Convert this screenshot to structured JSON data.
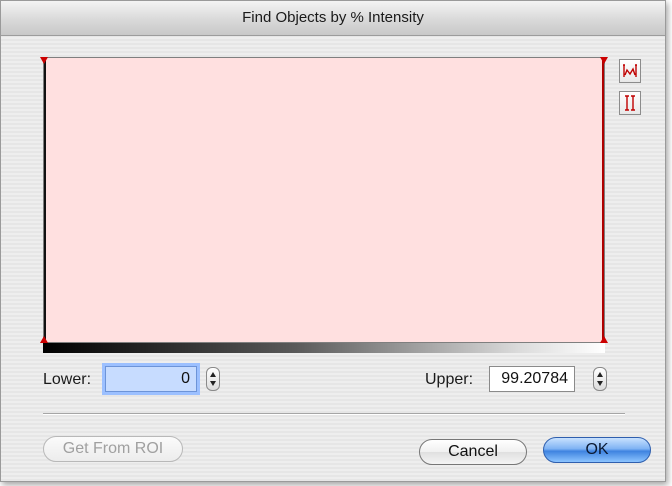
{
  "window": {
    "title": "Find Objects by % Intensity"
  },
  "histogram": {
    "fill_color": "#ffe0e0",
    "lower_marker_color": "#111111",
    "upper_marker_color": "#cc0000"
  },
  "side_tools": [
    {
      "name": "fit-histogram-icon"
    },
    {
      "name": "threshold-bracket-icon"
    }
  ],
  "lower": {
    "label": "Lower:",
    "value": "0"
  },
  "upper": {
    "label": "Upper:",
    "value": "99.20784"
  },
  "buttons": {
    "get_from_roi": "Get From ROI",
    "cancel": "Cancel",
    "ok": "OK"
  },
  "colors": {
    "default_button": "#3f83e0",
    "focus_ring": "#9cc0ff"
  }
}
